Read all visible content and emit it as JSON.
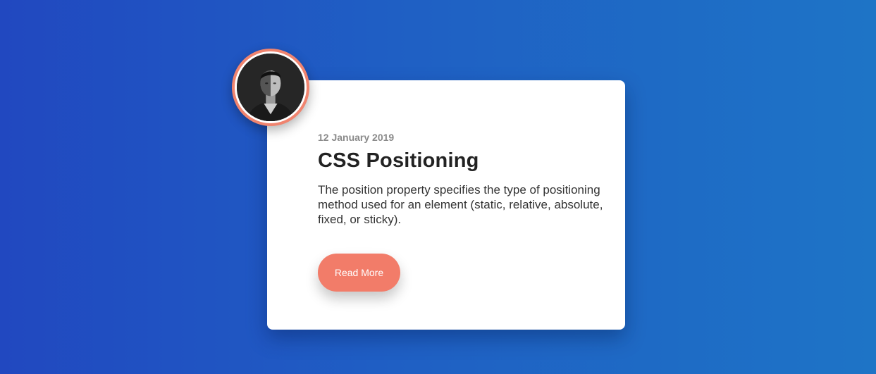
{
  "card": {
    "date": "12 January 2019",
    "title": "CSS Positioning",
    "description": "The position property specifies the type of positioning method used for an element (static, relative, absolute, fixed, or sticky).",
    "button_label": "Read More"
  },
  "colors": {
    "background_start": "#2148c0",
    "background_end": "#1e74c6",
    "accent": "#f27c69",
    "card": "#ffffff",
    "title": "#222222",
    "date": "#8a8a8a"
  },
  "icons": {
    "avatar": "author-avatar"
  }
}
